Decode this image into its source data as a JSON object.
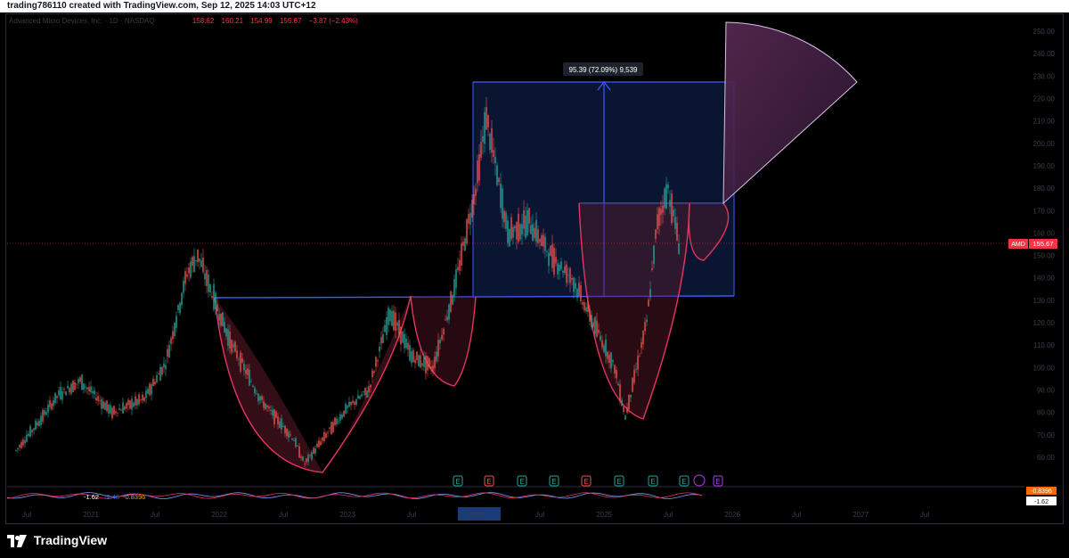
{
  "header": {
    "caption": "trading786110 created with TradingView.com, Sep 12, 2025 14:03 UTC+12"
  },
  "legend": {
    "symbol": "Advanced Micro Devices, Inc. · 1D · NASDAQ",
    "open": "158.62",
    "high": "160.21",
    "low": "154.99",
    "close": "155.67",
    "change": "−3.87 (−2.43%)"
  },
  "price_tag": {
    "ticker": "AMD",
    "price": "155.67",
    "color": "#f23645"
  },
  "measure": {
    "label": "95.39 (72.09%) 9,539"
  },
  "indicator": {
    "v1": "-1.62",
    "v2": "-2.46",
    "v3": "-0.8396",
    "axis_top": "-0.8396",
    "axis_bottom": "-1.62"
  },
  "events": [
    "E",
    "E",
    "E",
    "E",
    "E",
    "E",
    "E",
    "E",
    "E"
  ],
  "brand": "TradingView",
  "chart_data": {
    "type": "candlestick",
    "symbol": "AMD",
    "y_ticks": [
      "250.00",
      "240.00",
      "230.00",
      "220.00",
      "210.00",
      "200.00",
      "190.00",
      "180.00",
      "170.00",
      "160.00",
      "150.00",
      "140.00",
      "130.00",
      "120.00",
      "110.00",
      "100.00",
      "90.00",
      "80.00",
      "70.00",
      "60.00"
    ],
    "x_ticks": [
      "Jul",
      "2021",
      "Jul",
      "2022",
      "Jul",
      "2023",
      "Jul",
      "2024",
      "Jul",
      "2025",
      "Jul",
      "2026",
      "Jul",
      "2027",
      "Jul"
    ],
    "ylim": [
      55,
      255
    ],
    "price_path": [
      [
        "2020-07",
        63
      ],
      [
        "2020-09",
        75
      ],
      [
        "2020-11",
        88
      ],
      [
        "2021-01",
        94
      ],
      [
        "2021-04",
        80
      ],
      [
        "2021-07",
        86
      ],
      [
        "2021-09",
        102
      ],
      [
        "2021-11",
        142
      ],
      [
        "2021-12",
        150
      ],
      [
        "2022-03",
        112
      ],
      [
        "2022-06",
        85
      ],
      [
        "2022-09",
        68
      ],
      [
        "2022-10",
        57
      ],
      [
        "2022-12",
        70
      ],
      [
        "2023-02",
        82
      ],
      [
        "2023-04",
        90
      ],
      [
        "2023-06",
        125
      ],
      [
        "2023-08",
        105
      ],
      [
        "2023-10",
        100
      ],
      [
        "2023-12",
        135
      ],
      [
        "2024-02",
        180
      ],
      [
        "2024-03",
        212
      ],
      [
        "2024-05",
        160
      ],
      [
        "2024-07",
        165
      ],
      [
        "2024-09",
        150
      ],
      [
        "2024-11",
        140
      ],
      [
        "2025-01",
        120
      ],
      [
        "2025-03",
        100
      ],
      [
        "2025-04",
        78
      ],
      [
        "2025-06",
        120
      ],
      [
        "2025-07",
        165
      ],
      [
        "2025-08",
        180
      ],
      [
        "2025-09",
        155.67
      ]
    ],
    "measure": {
      "from": 116.82,
      "to": 212.21,
      "change": 95.39,
      "percent": 72.09,
      "ticks": 9539
    }
  }
}
